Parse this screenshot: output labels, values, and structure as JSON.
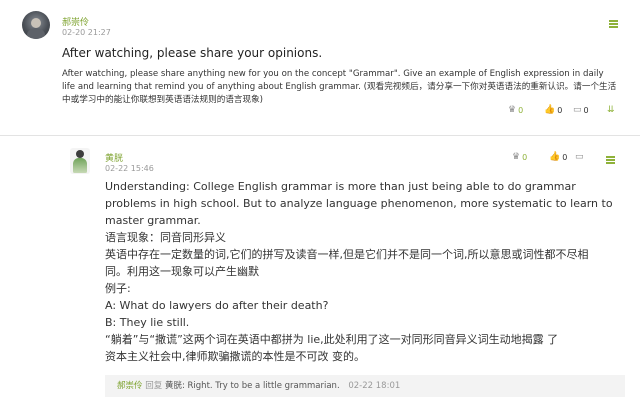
{
  "post": {
    "username": "郝崇伶",
    "timestamp": "02-20 21:27",
    "title": "After watching, please share your opinions.",
    "body": "After watching, please share anything new for you on the concept \"Grammar\". Give an example of English expression in daily life and learning that remind you of anything about English grammar. (观看完视频后，请分享一下你对英语语法的重新认识。请一个生活中或学习中的能让你联想到英语语法规则的语言现象)",
    "stats": [
      {
        "icon": "trophy-icon",
        "count": "0"
      },
      {
        "icon": "thumbs-up-icon",
        "count": "0"
      },
      {
        "icon": "comment-icon",
        "count": "0"
      },
      {
        "icon": "download-icon",
        "count": ""
      }
    ]
  },
  "reply": {
    "username": "黄胱",
    "timestamp": "02-22 15:46",
    "stats": [
      {
        "icon": "trophy-icon",
        "count": "0"
      },
      {
        "icon": "thumbs-up-icon",
        "count": "0"
      }
    ],
    "lines": [
      "Understanding: College English grammar is more than just being able to do grammar",
      "problems in high school. But to analyze language phenomenon, more systematic to learn to",
      "master grammar.",
      "语言现象：同音同形异义",
      "英语中存在一定数量的词,它们的拼写及读音一样,但是它们并不是同一个词,所以意思或词性都不尽相",
      "同。利用这一现象可以产生幽默",
      "例子:",
      "A: What do lawyers do after their death?",
      "B: They lie still.",
      "“躺着”与“撒谎”这两个词在英语中都拼为 lie,此处利用了这一对同形同音异义词生动地揭露 了",
      "资本主义社会中,律师欺骗撒谎的本性是不可改 变的。"
    ]
  },
  "sub_reply": {
    "username": "郝崇伶",
    "reply_label": "回复",
    "target": "黄胱:",
    "text": "Right. Try to be a little grammarian.",
    "timestamp": "02-22 18:01"
  }
}
